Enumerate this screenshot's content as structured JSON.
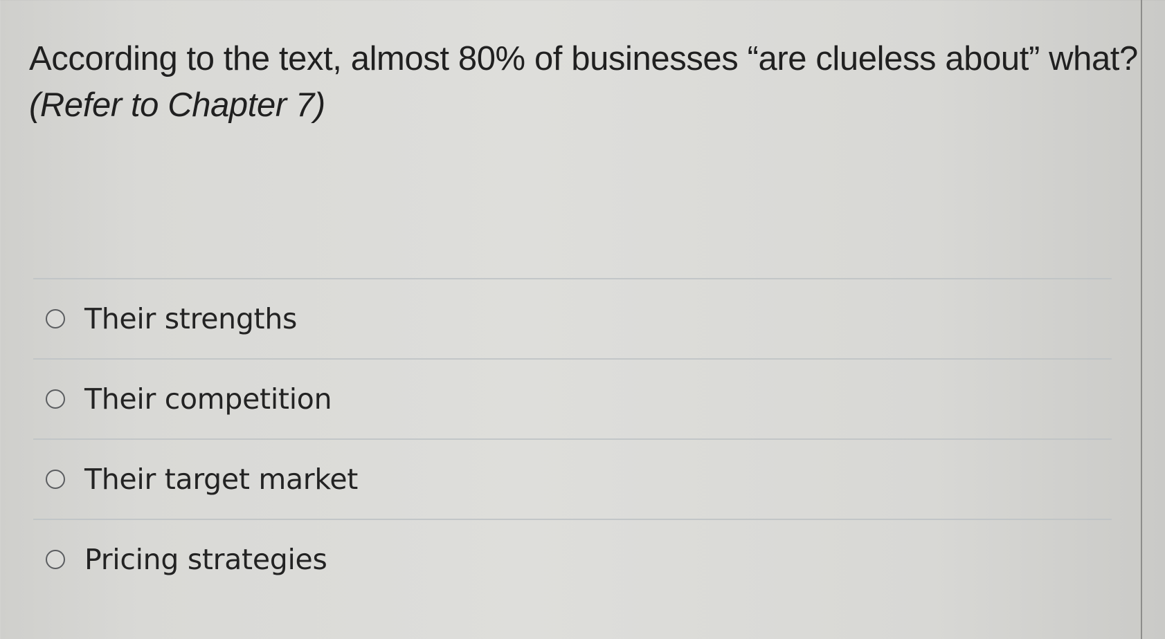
{
  "question": {
    "main": "According to the text, almost 80% of businesses “are clueless about” what?",
    "reference": "(Refer to Chapter 7)"
  },
  "answers": [
    {
      "label": "Their strengths"
    },
    {
      "label": "Their competition"
    },
    {
      "label": "Their target market"
    },
    {
      "label": "Pricing strategies"
    }
  ]
}
